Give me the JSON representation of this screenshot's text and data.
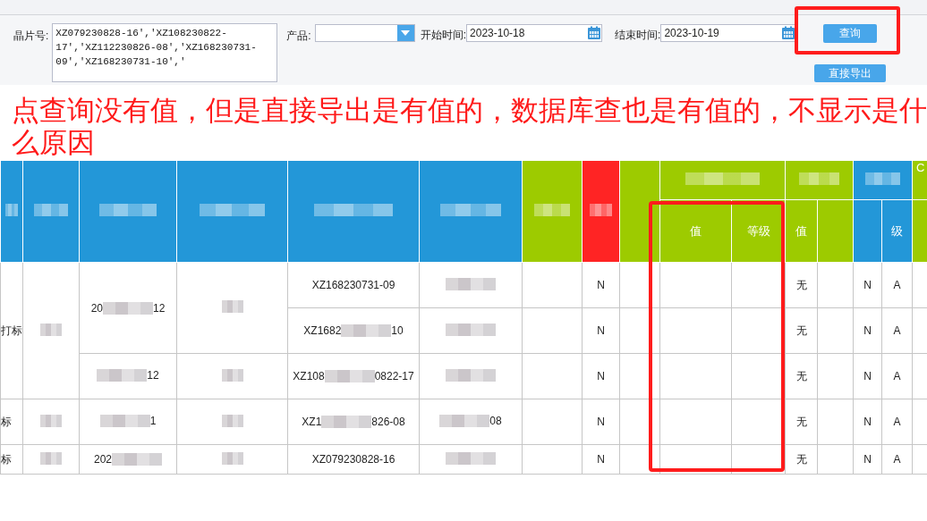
{
  "filters": {
    "chip_label": "晶片号:",
    "chip_value": "XZ079230828-16','XZ108230822-17','XZ112230826-08','XZ168230731-09','XZ168230731-10','",
    "product_label": "产品:",
    "start_label": "开始时间:",
    "start_value": "2023-10-18",
    "end_label": "结束时间:",
    "end_value": "2023-10-19"
  },
  "buttons": [
    {
      "label": "查询"
    },
    {
      "label": "直接导出"
    }
  ],
  "query_button_highlighted": true,
  "annotation": "点查询没有值，但是直接导出是有值的，数据库查也是有值的，不显示是什么原因",
  "table": {
    "corner_label": "C",
    "value_columns": {
      "labels": [
        "值",
        "等级"
      ],
      "highlighted": true
    },
    "other_labels": [
      "值"
    ],
    "right_labels": [
      "级"
    ],
    "rows": [
      {
        "group": {
          "label": "打标"
        },
        "date": {
          "kind": "redacted",
          "before": "20",
          "after": "12"
        },
        "chip_id": {
          "kind": "plain",
          "text": "XZ168230731-09"
        },
        "col_5": {
          "kind": "redacted"
        },
        "col_7": "N",
        "col_11": "无",
        "col_13": "N",
        "col_14": "A"
      },
      {
        "chip_id": {
          "kind": "redacted",
          "before": "XZ1682",
          "after": "10"
        },
        "col_5": {
          "kind": "redacted"
        },
        "col_7": "N",
        "col_11": "无",
        "col_13": "N",
        "col_14": "A"
      },
      {
        "date": {
          "kind": "redacted",
          "after": "12"
        },
        "chip_id": {
          "kind": "redacted",
          "before": "XZ108",
          "after": "0822-17"
        },
        "col_5": {
          "kind": "redacted"
        },
        "col_7": "N",
        "col_11": "无",
        "col_13": "N",
        "col_14": "A"
      },
      {
        "group": {
          "label": "标"
        },
        "date": {
          "kind": "redacted",
          "after": "1"
        },
        "chip_id": {
          "kind": "redacted",
          "before": "XZ1",
          "after": "826-08"
        },
        "col_5": {
          "kind": "redacted",
          "after": "08"
        },
        "col_7": "N",
        "col_11": "无",
        "col_13": "N",
        "col_14": "A"
      },
      {
        "group": {
          "label": "标"
        },
        "date": {
          "kind": "redacted",
          "before": "202"
        },
        "chip_id": {
          "kind": "plain",
          "text": "XZ079230828-16"
        },
        "col_5": {
          "kind": "redacted"
        },
        "col_7": "N",
        "col_11": "无",
        "col_13": "N",
        "col_14": "A"
      }
    ]
  }
}
